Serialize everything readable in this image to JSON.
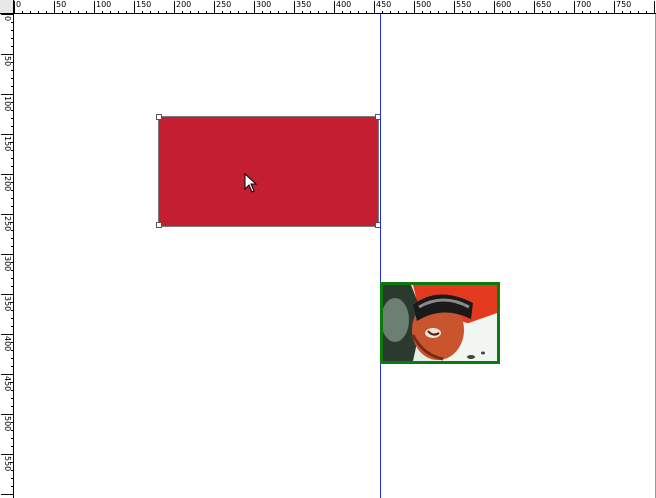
{
  "ruler": {
    "top_labels": [
      "0",
      "50",
      "100",
      "150",
      "200",
      "250",
      "300",
      "350",
      "400",
      "450",
      "500",
      "550",
      "600",
      "650",
      "700",
      "750"
    ],
    "left_labels": [
      "0",
      "50",
      "100",
      "150",
      "200",
      "250",
      "300",
      "350",
      "400",
      "450",
      "500",
      "550"
    ]
  },
  "canvas": {
    "guide_color": "#2030c8",
    "shape_fill": "#c41e32",
    "image_border": "#0c7a0c"
  },
  "image": {
    "icon": "comic-character-picture"
  },
  "cursor": {
    "icon": "arrow-cursor-icon"
  }
}
